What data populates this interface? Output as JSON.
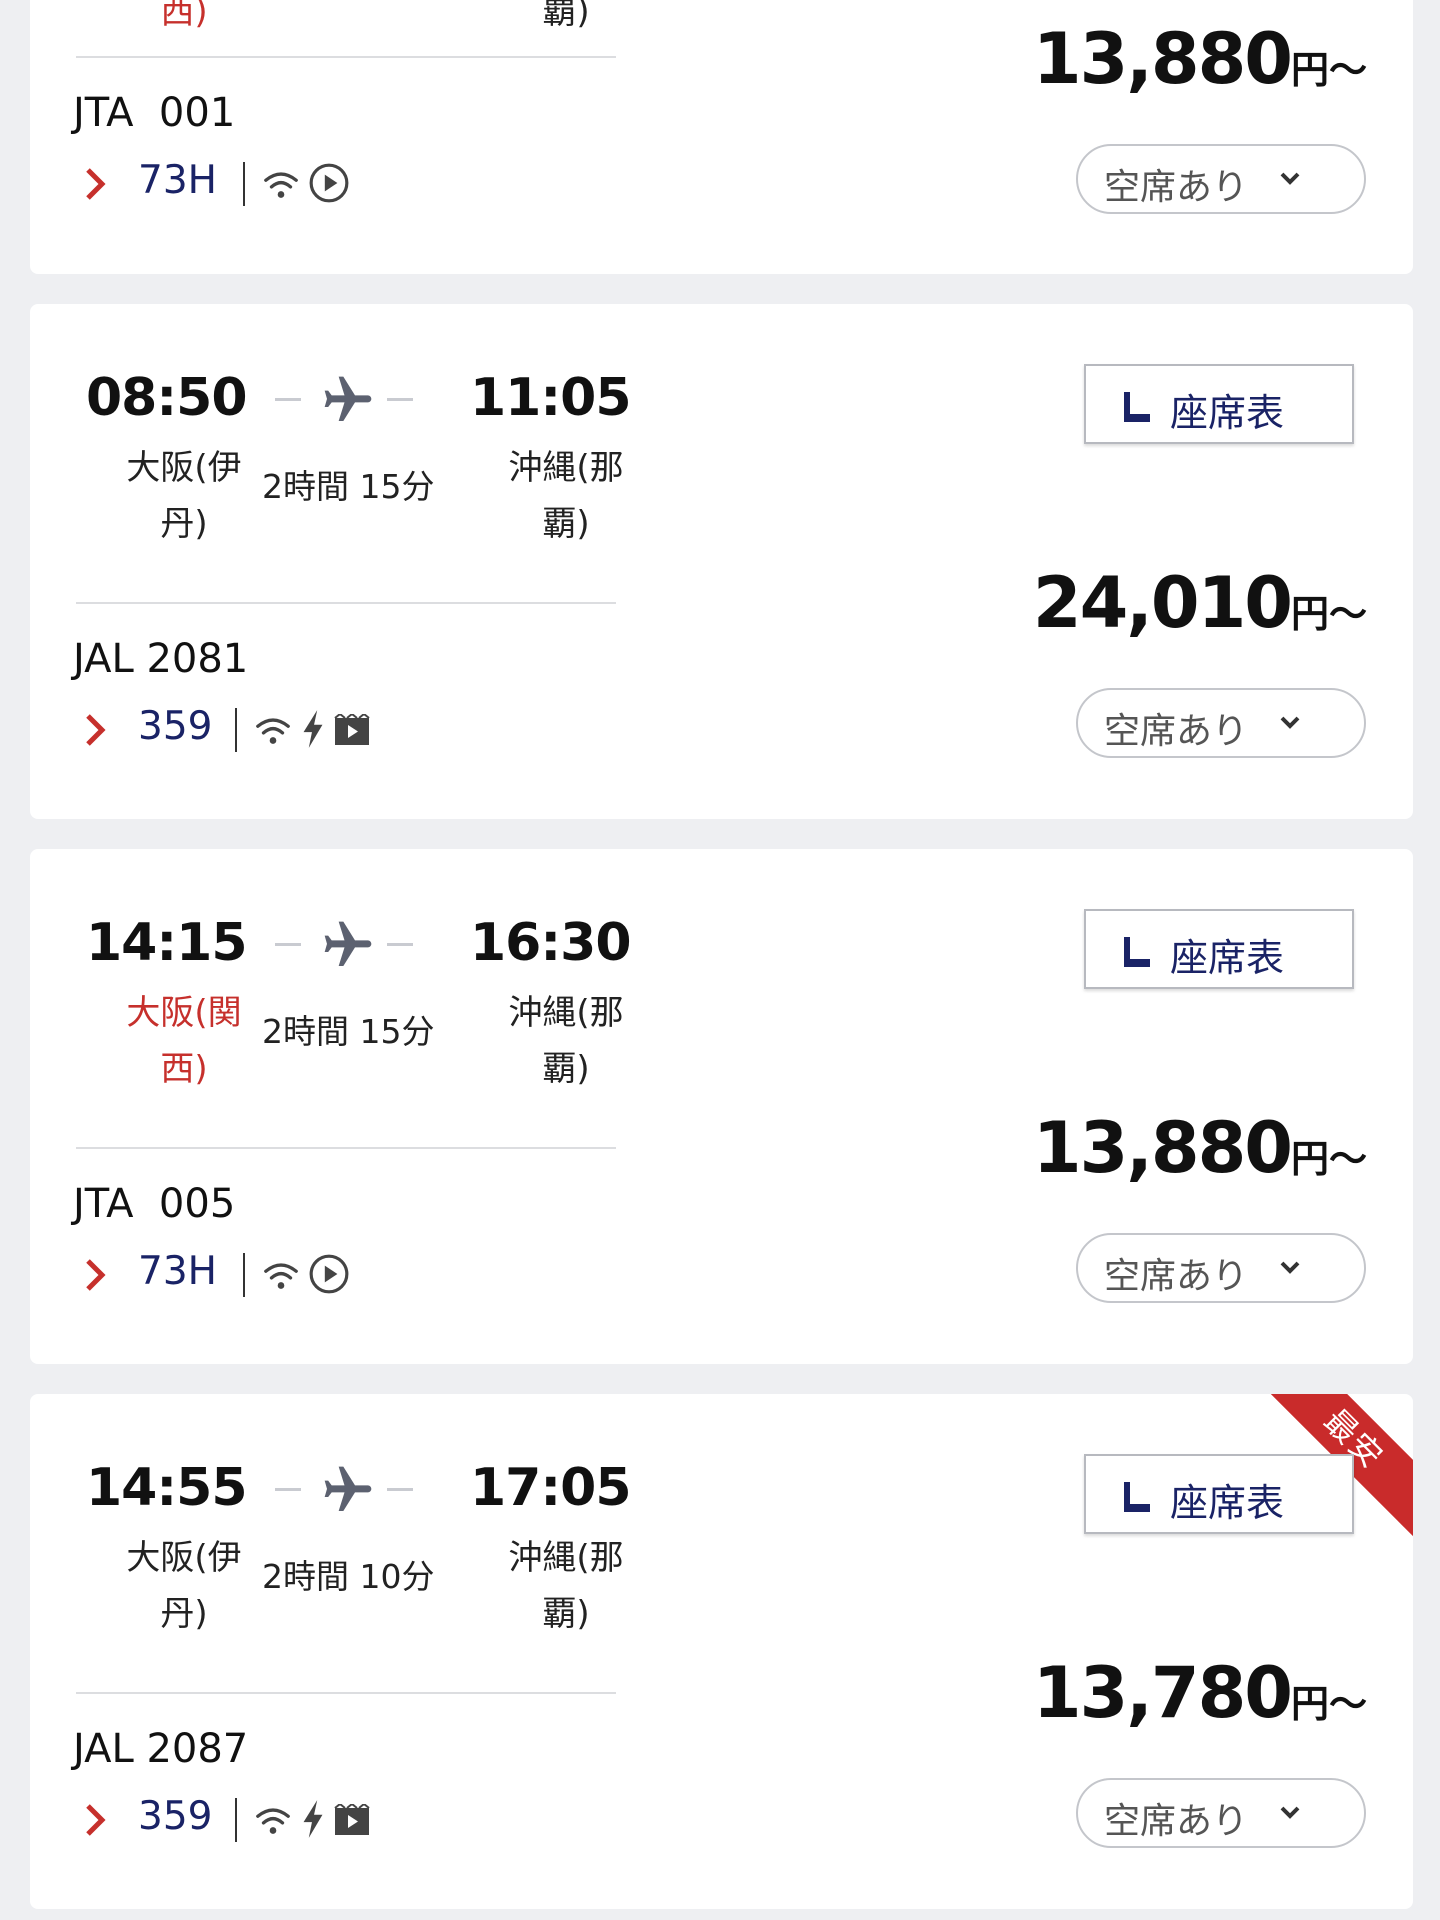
{
  "colors": {
    "accent_red": "#c6302c",
    "navy": "#1a2366",
    "badge_red": "#c92b2b"
  },
  "card0": {
    "partial_city_left": "西)",
    "partial_city_right": "覇)",
    "flight_no": "JTA  001",
    "aircraft": "73H",
    "amenities": [
      "wifi-icon",
      "play-icon"
    ],
    "price": "13,880",
    "price_unit": "円〜",
    "availability": "空席あり"
  },
  "flights": [
    {
      "dep_time": "08:50",
      "arr_time": "11:05",
      "dep_city": "大阪(伊丹)",
      "arr_city": "沖縄(那覇)",
      "duration": "2時間 15分",
      "flight_no": "JAL 2081",
      "aircraft": "359",
      "amenities": [
        "wifi-icon",
        "power-icon",
        "video-icon"
      ],
      "seat_map": "座席表",
      "price": "24,010",
      "price_unit": "円〜",
      "availability": "空席あり"
    },
    {
      "dep_time": "14:15",
      "arr_time": "16:30",
      "dep_city": "大阪(関西)",
      "arr_city": "沖縄(那覇)",
      "duration": "2時間 15分",
      "flight_no": "JTA  005",
      "aircraft": "73H",
      "amenities": [
        "wifi-icon",
        "play-icon"
      ],
      "seat_map": "座席表",
      "price": "13,880",
      "price_unit": "円〜",
      "availability": "空席あり"
    },
    {
      "dep_time": "14:55",
      "arr_time": "17:05",
      "dep_city": "大阪(伊丹)",
      "arr_city": "沖縄(那覇)",
      "duration": "2時間 10分",
      "flight_no": "JAL 2087",
      "aircraft": "359",
      "amenities": [
        "wifi-icon",
        "power-icon",
        "video-icon"
      ],
      "seat_map": "座席表",
      "price": "13,780",
      "price_unit": "円〜",
      "availability": "空席あり",
      "badge": "最安"
    }
  ]
}
